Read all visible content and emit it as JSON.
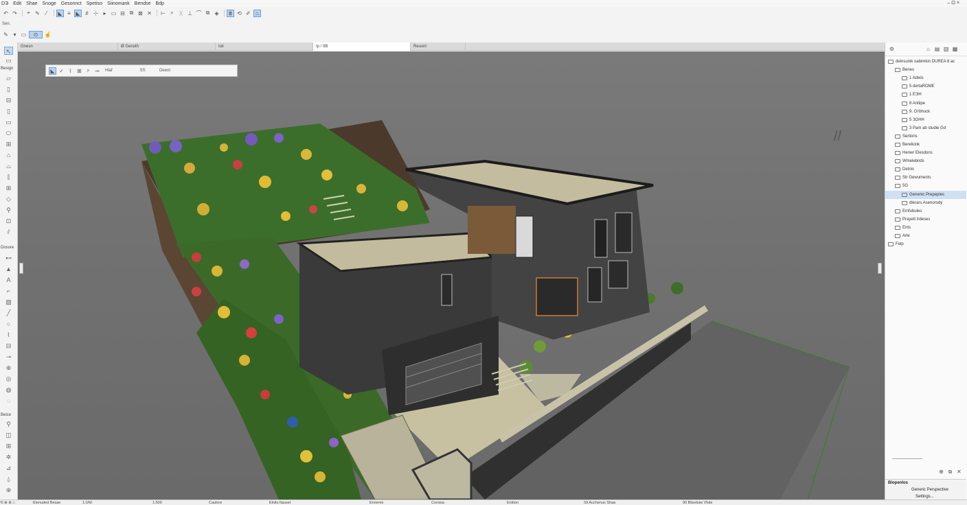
{
  "menu": [
    "DЭ",
    "Edit",
    "Shae",
    "Snoge",
    "Gesonnct",
    "Spetiso",
    "Siinomank",
    "Bendse",
    "Bdp"
  ],
  "window_controls": "– ⊡ ×",
  "quick_options_label": "Sen.",
  "tabs": [
    {
      "label": "Gnesn"
    },
    {
      "label": "Ø Genoth"
    },
    {
      "label": "Ioli"
    },
    {
      "label": "Ip / 9B"
    },
    {
      "label": "Reusnt"
    }
  ],
  "toolbox": {
    "categories": [
      "Besign",
      "Dosure",
      "Beice"
    ]
  },
  "floating_toolbar": {
    "layer": "Hlaf",
    "field_a": "SS",
    "field_b": "Oeent"
  },
  "navigator": {
    "tree": [
      {
        "label": "delnsunik oabimkin DUREA 8 ac",
        "indent": 0,
        "sel": false
      },
      {
        "label": "Benes",
        "indent": 1,
        "sel": false
      },
      {
        "label": "1 Adwis",
        "indent": 2,
        "sel": false
      },
      {
        "label": "5 dertaROME",
        "indent": 2,
        "sel": false
      },
      {
        "label": "1 ЕЭН",
        "indent": 2,
        "sel": false
      },
      {
        "label": "8 Antiipe",
        "indent": 2,
        "sel": false
      },
      {
        "label": "9. Отbhuck",
        "indent": 2,
        "sel": false
      },
      {
        "label": "5 ЗОНН",
        "indent": 2,
        "sel": false
      },
      {
        "label": "3 Pam ab studie Gd",
        "indent": 2,
        "sel": false
      },
      {
        "label": "Serlions",
        "indent": 1,
        "sel": false
      },
      {
        "label": "Berelionk",
        "indent": 1,
        "sel": false
      },
      {
        "label": "Henwr Elesdons",
        "indent": 1,
        "sel": false
      },
      {
        "label": "Wmelebnds",
        "indent": 1,
        "sel": false
      },
      {
        "label": "Detnis",
        "indent": 1,
        "sel": false
      },
      {
        "label": "Str Gewuments",
        "indent": 1,
        "sel": false
      },
      {
        "label": "5G",
        "indent": 1,
        "sel": false
      },
      {
        "label": "Genenic Prepeples",
        "indent": 2,
        "sel": true
      },
      {
        "label": "dlerars Asenorody",
        "indent": 2,
        "sel": false
      },
      {
        "label": "Emfubules",
        "indent": 1,
        "sel": false
      },
      {
        "label": "Prayett Irdeses",
        "indent": 1,
        "sel": false
      },
      {
        "label": "Ents",
        "indent": 1,
        "sel": false
      },
      {
        "label": "Arle",
        "indent": 1,
        "sel": false
      },
      {
        "label": "Felp",
        "indent": 0,
        "sel": false
      }
    ],
    "props_header": "Blopenlos",
    "props_value": "Generic Perspective",
    "settings_button": "Settings..."
  },
  "status_bar": [
    "Elenuded Besae",
    "1:UNI",
    "1:500",
    "Caulore",
    "Elnits Ilauset",
    "Enmmm",
    "Coroisa",
    "Enition",
    "Sli Auchenus Shaa",
    "90 Bliseluiw Vhde"
  ],
  "colors": {
    "viewport_bg": "#737373",
    "accent": "#6f9fd4",
    "wall": "#3e3e3e",
    "roof": "#bdb69a"
  }
}
